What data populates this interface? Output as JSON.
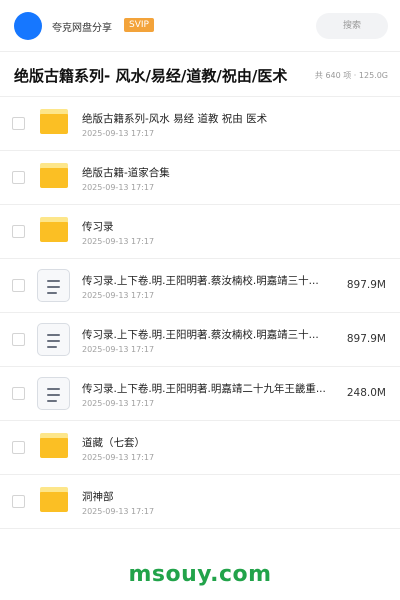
{
  "header": {
    "share_name": "夸克网盘分享",
    "badge": "SVIP",
    "search_placeholder": "搜索",
    "avatar_color": "#1677ff"
  },
  "titlebar": {
    "title": "绝版古籍系列- 风水/易经/道教/祝由/医术",
    "summary": "共 640 项 · 125.0G"
  },
  "items": [
    {
      "type": "folder",
      "name": "绝版古籍系列-风水 易经 道教 祝由 医术",
      "date": "2025-09-13 17:17",
      "size": ""
    },
    {
      "type": "folder",
      "name": "绝版古籍-道家合集",
      "date": "2025-09-13 17:17",
      "size": ""
    },
    {
      "type": "folder",
      "name": "传习录",
      "date": "2025-09-13 17:17",
      "size": ""
    },
    {
      "type": "file",
      "name": "传习录.上下卷.明.王阳明著.蔡汝楠校.明嘉靖三十...",
      "date": "2025-09-13 17:17",
      "size": "897.9M"
    },
    {
      "type": "file",
      "name": "传习录.上下卷.明.王阳明著.蔡汝楠校.明嘉靖三十...",
      "date": "2025-09-13 17:17",
      "size": "897.9M"
    },
    {
      "type": "file",
      "name": "传习录.上下卷.明.王阳明著.明嘉靖二十九年王畿重...",
      "date": "2025-09-13 17:17",
      "size": "248.0M"
    },
    {
      "type": "folder",
      "name": "道藏（七套）",
      "date": "2025-09-13 17:17",
      "size": ""
    },
    {
      "type": "folder",
      "name": "洞神部",
      "date": "2025-09-13 17:17",
      "size": ""
    }
  ],
  "watermark": "msouy.com",
  "colors": {
    "accent": "#1677ff",
    "folder": "#fbbf24",
    "badge": "#f3a33a",
    "watermark": "#22a34a"
  }
}
